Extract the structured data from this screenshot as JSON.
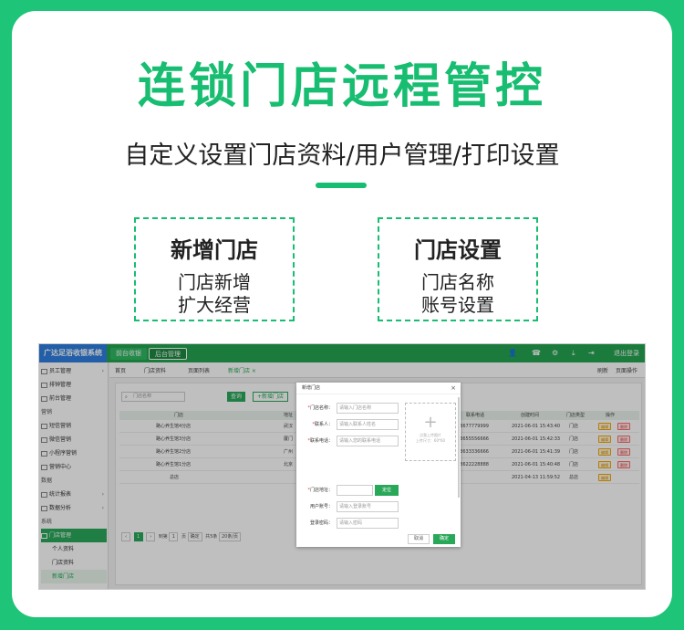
{
  "banner": {
    "title": "连锁门店远程管控",
    "subtitle": "自定义设置门店资料/用户管理/打印设置",
    "features": [
      {
        "title": "新增门店",
        "lines": [
          "门店新增",
          "扩大经营"
        ]
      },
      {
        "title": "门店设置",
        "lines": [
          "门店名称",
          "账号设置"
        ]
      }
    ]
  },
  "app": {
    "logo": "广达足浴收银系统",
    "top_tabs": [
      "前台收银",
      "后台管理"
    ],
    "exit_label": "退出登录",
    "sidebar": [
      {
        "label": "员工管理",
        "arrow": "›"
      },
      {
        "label": "排钟管理",
        "arrow": ""
      },
      {
        "label": "前台管理",
        "arrow": ""
      },
      {
        "label": "营销",
        "arrow": ""
      },
      {
        "label": "短信营销",
        "arrow": ""
      },
      {
        "label": "微信营销",
        "arrow": ""
      },
      {
        "label": "小程序营销",
        "arrow": ""
      },
      {
        "label": "营销中心",
        "arrow": ""
      },
      {
        "label": "数据",
        "arrow": ""
      },
      {
        "label": "统计报表",
        "arrow": "›"
      },
      {
        "label": "数据分析",
        "arrow": "›"
      },
      {
        "label": "系统",
        "arrow": ""
      },
      {
        "label": "门店管理",
        "arrow": "⌄"
      },
      {
        "label": "个人资料",
        "arrow": ""
      },
      {
        "label": "门店资料",
        "arrow": ""
      },
      {
        "label": "新增门店",
        "arrow": ""
      }
    ],
    "tabs": [
      "首页",
      "门店资料",
      "页面列表",
      "新增门店 ×"
    ],
    "tab_right": [
      "刷新",
      "页面操作"
    ],
    "search_placeholder": "门店名称",
    "query_label": "查询",
    "add_label": "+新增门店",
    "columns": [
      "门店",
      "地址",
      "联系电话",
      "创建时间",
      "门店类型",
      "操作"
    ],
    "rows": [
      {
        "store": "路心养生馆4分店",
        "addr": "武汉",
        "phone": "13677779999",
        "time": "2021-06-01 15:43:40",
        "type": "门店"
      },
      {
        "store": "路心养生馆3分店",
        "addr": "厦门",
        "phone": "13655556666",
        "time": "2021-06-01 15:42:33",
        "type": "门店"
      },
      {
        "store": "路心养生馆2分店",
        "addr": "广州",
        "phone": "13633336666",
        "time": "2021-06-01 15:41:39",
        "type": "门店"
      },
      {
        "store": "路心养生馆1分店",
        "addr": "北京",
        "phone": "13622228888",
        "time": "2021-06-01 15:40:48",
        "type": "门店"
      },
      {
        "store": "总店",
        "addr": "",
        "phone": "",
        "time": "2021-04-13 11:59:52",
        "type": "总店"
      }
    ],
    "edit_label": "编辑",
    "delete_label": "删除",
    "pager": {
      "current": "1",
      "goto": "到第",
      "page": "1",
      "unit": "页",
      "confirm": "确定",
      "total": "共5条",
      "per_page": "20条/页"
    },
    "modal": {
      "title": "新增门店",
      "fields": [
        {
          "label": "门店名称：",
          "placeholder": "请输入门店名称",
          "required": true
        },
        {
          "label": "联系人：",
          "placeholder": "请输入联系人姓名",
          "required": true
        },
        {
          "label": "联系电话：",
          "placeholder": "请输入您的联系电话",
          "required": true
        },
        {
          "label": "门店地址：",
          "placeholder": "",
          "required": true
        },
        {
          "label": "用户账号：",
          "placeholder": "请输入登录账号",
          "required": false
        },
        {
          "label": "登录密码：",
          "placeholder": "请输入密码",
          "required": false
        },
        {
          "label": "确认密码：",
          "placeholder": "请再次输入密码",
          "required": false
        },
        {
          "label": "用户角色：",
          "placeholder": "请选择角色",
          "required": false
        }
      ],
      "locate_label": "定位",
      "upload_text": [
        "点我上传图片",
        "上传尺寸：60*60"
      ],
      "cancel_label": "取消",
      "ok_label": "确定"
    }
  }
}
